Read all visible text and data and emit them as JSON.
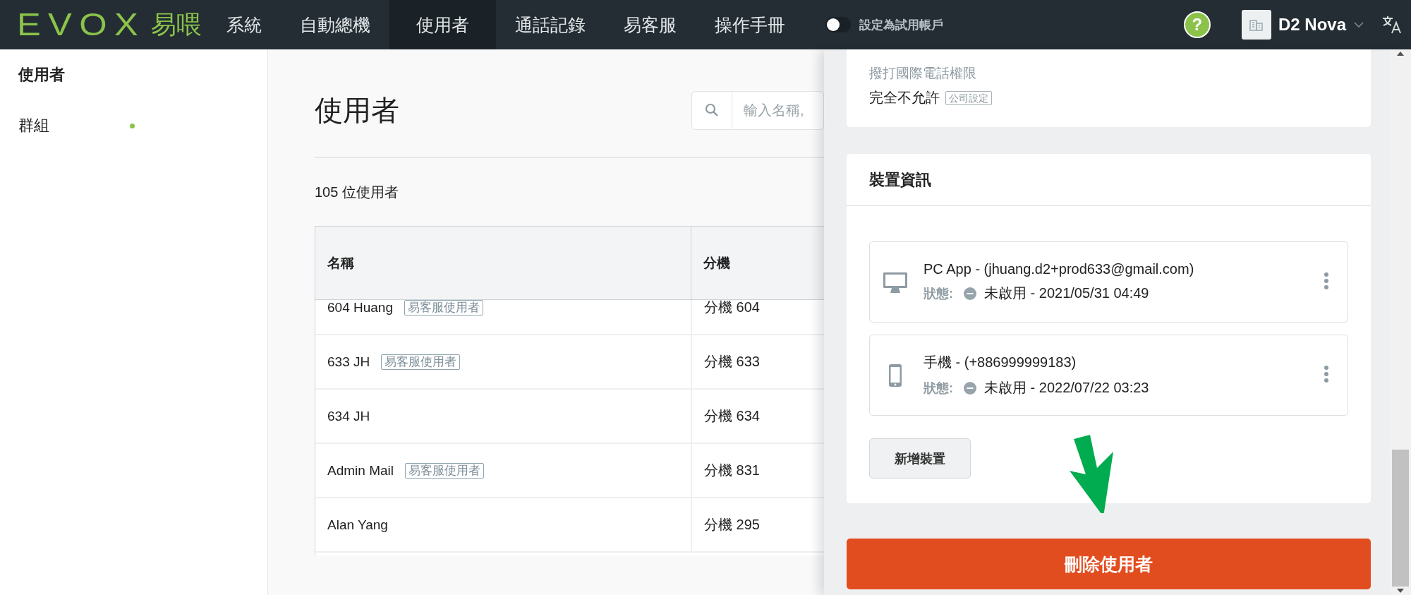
{
  "nav": {
    "logo": "EVOX",
    "logo_cjk": "易喂",
    "items": [
      {
        "label": "系統",
        "selected": false
      },
      {
        "label": "自動總機",
        "selected": false
      },
      {
        "label": "使用者",
        "selected": true
      },
      {
        "label": "通話記錄",
        "selected": false
      },
      {
        "label": "易客服",
        "selected": false
      },
      {
        "label": "操作手冊",
        "selected": false
      }
    ],
    "trial_toggle": {
      "label": "設定為試用帳戶",
      "on": false
    },
    "help": "?",
    "account": "D2 Nova"
  },
  "sidebar": {
    "items": [
      {
        "label": "使用者",
        "selected": true,
        "dot": false
      },
      {
        "label": "群組",
        "selected": false,
        "dot": true
      }
    ]
  },
  "main": {
    "title": "使用者",
    "search": {
      "placeholder": "輸入名稱,"
    },
    "count": "105 位使用者",
    "table": {
      "columns": [
        "名稱",
        "分機"
      ],
      "rows": [
        {
          "name": "604 Huang",
          "tag": "易客服使用者",
          "extension": "分機 604"
        },
        {
          "name": "633 JH",
          "tag": "易客服使用者",
          "extension": "分機 633"
        },
        {
          "name": "634 JH",
          "extension": "分機 634"
        },
        {
          "name": "Admin Mail",
          "tag": "易客服使用者",
          "extension": "分機 831"
        },
        {
          "name": "Alan Yang",
          "extension": "分機 295"
        }
      ]
    }
  },
  "panel": {
    "permission": {
      "label": "撥打國際電話權限",
      "value": "完全不允許",
      "tag": "公司設定"
    },
    "devices": {
      "title": "裝置資訊",
      "items": [
        {
          "kind": "desktop",
          "name": "PC App - (jhuang.d2+prod633@gmail.com)",
          "status_label": "狀態:",
          "status": "未啟用 - 2021/05/31 04:49"
        },
        {
          "kind": "phone",
          "name": "手機 - (+886999999183)",
          "status_label": "狀態:",
          "status": "未啟用 - 2022/07/22 03:23"
        }
      ],
      "add_button": "新增裝置"
    },
    "delete_button": "刪除使用者"
  }
}
